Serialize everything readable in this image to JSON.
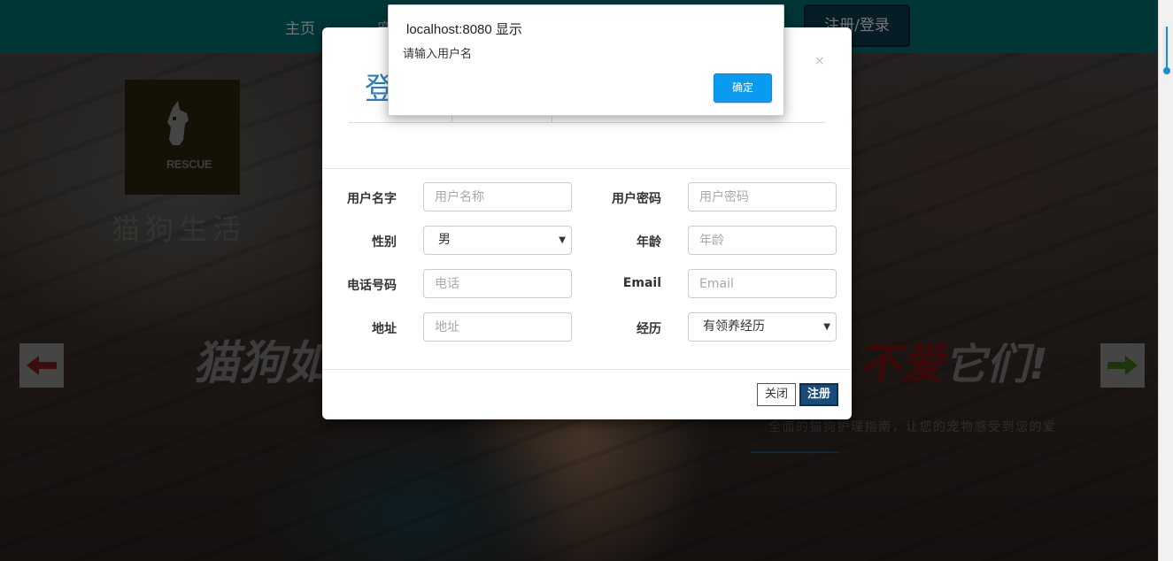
{
  "navbar": {
    "home_label": "主页",
    "partial_label": "宠",
    "register_login_label": "注册/登录",
    "color": "#036d6d"
  },
  "hero": {
    "logo_text": "RESCUE",
    "site_name": "猫狗生活",
    "headline_left": "猫狗如",
    "headline_red": "不爱",
    "headline_gray": "它们!",
    "subtitle": "全面的猫狗护理指南，让您的宠物感受到您的爱",
    "prev_icon": "arrow-left-icon",
    "next_icon": "arrow-right-icon"
  },
  "modal": {
    "title": "登",
    "close_label": "×",
    "fields": {
      "username_label": "用户名字",
      "username_placeholder": "用户名称",
      "password_label": "用户密码",
      "password_placeholder": "用户密码",
      "gender_label": "性别",
      "gender_value": "男",
      "age_label": "年龄",
      "age_placeholder": "年龄",
      "phone_label": "电话号码",
      "phone_placeholder": "电话",
      "email_label": "Email",
      "email_placeholder": "Email",
      "address_label": "地址",
      "address_placeholder": "地址",
      "experience_label": "经历",
      "experience_value": "有领养经历"
    },
    "close_button": "关闭",
    "register_button": "注册"
  },
  "alert": {
    "title": "localhost:8080 显示",
    "message": "请输入用户名",
    "ok_label": "确定",
    "accent": "#0a9af0"
  }
}
